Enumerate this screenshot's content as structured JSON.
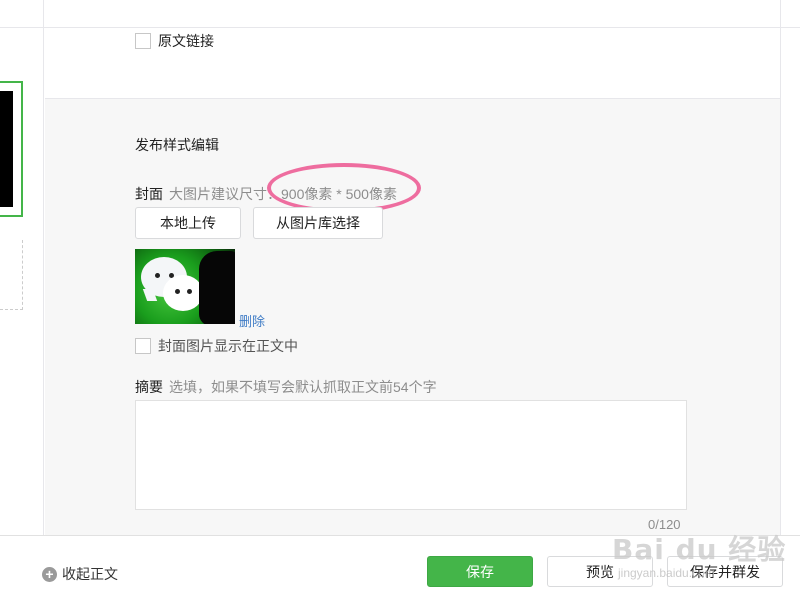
{
  "editor": {
    "original_link_label": "原文链接",
    "section_title": "发布样式编辑",
    "cover": {
      "label": "封面",
      "hint": "大图片建议尺寸：900像素 * 500像素",
      "upload_button": "本地上传",
      "library_button": "从图片库选择",
      "delete_link": "删除",
      "show_in_body_label": "封面图片显示在正文中"
    },
    "abstract": {
      "label": "摘要",
      "hint": "选填，如果不填写会默认抓取正文前54个字",
      "value": "",
      "counter": "0/120"
    }
  },
  "bottom_bar": {
    "collapse_label": "收起正文",
    "save_button": "保存",
    "preview_button": "预览",
    "publish_button": "保存并群发"
  },
  "watermark": {
    "text": "Bai du 经验",
    "url": "jingyan.baidu.com"
  },
  "colors": {
    "primary_green": "#44b549",
    "link_blue": "#3f7cc6",
    "annotation_pink": "#ee6d9f"
  }
}
